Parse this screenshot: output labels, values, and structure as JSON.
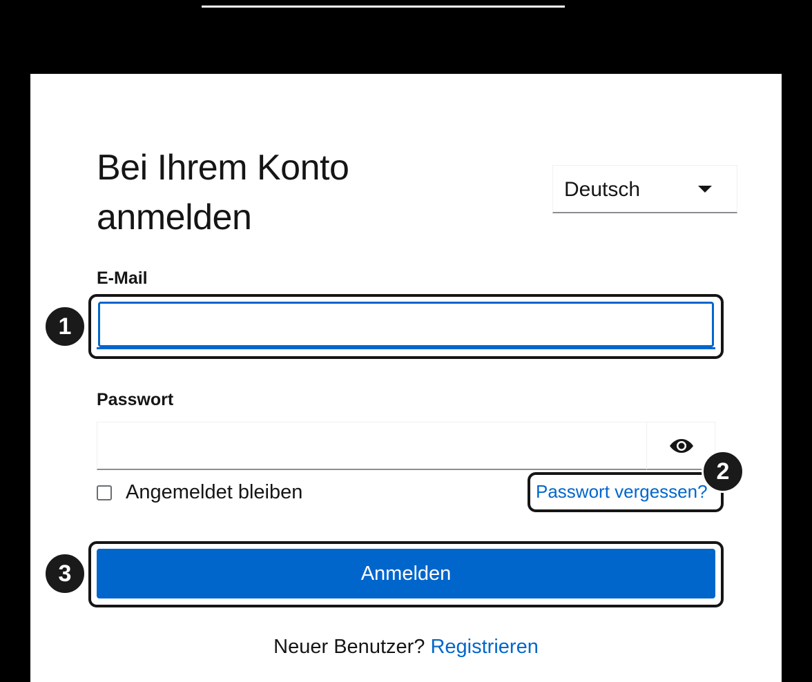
{
  "login": {
    "title": "Bei Ihrem Konto anmelden",
    "language": {
      "selected": "Deutsch"
    },
    "email": {
      "label": "E-Mail",
      "value": ""
    },
    "password": {
      "label": "Passwort",
      "value": "",
      "toggle_icon": "eye-icon"
    },
    "remember_me": {
      "label": "Angemeldet bleiben",
      "checked": false
    },
    "forgot_password": "Passwort vergessen?",
    "submit_label": "Anmelden",
    "register": {
      "prompt": "Neuer Benutzer?",
      "link": "Registrieren"
    }
  },
  "annotations": {
    "badge_1": "1",
    "badge_2": "2",
    "badge_3": "3"
  },
  "colors": {
    "primary": "#0066cc",
    "text": "#151515",
    "background": "#000000",
    "card": "#ffffff"
  }
}
